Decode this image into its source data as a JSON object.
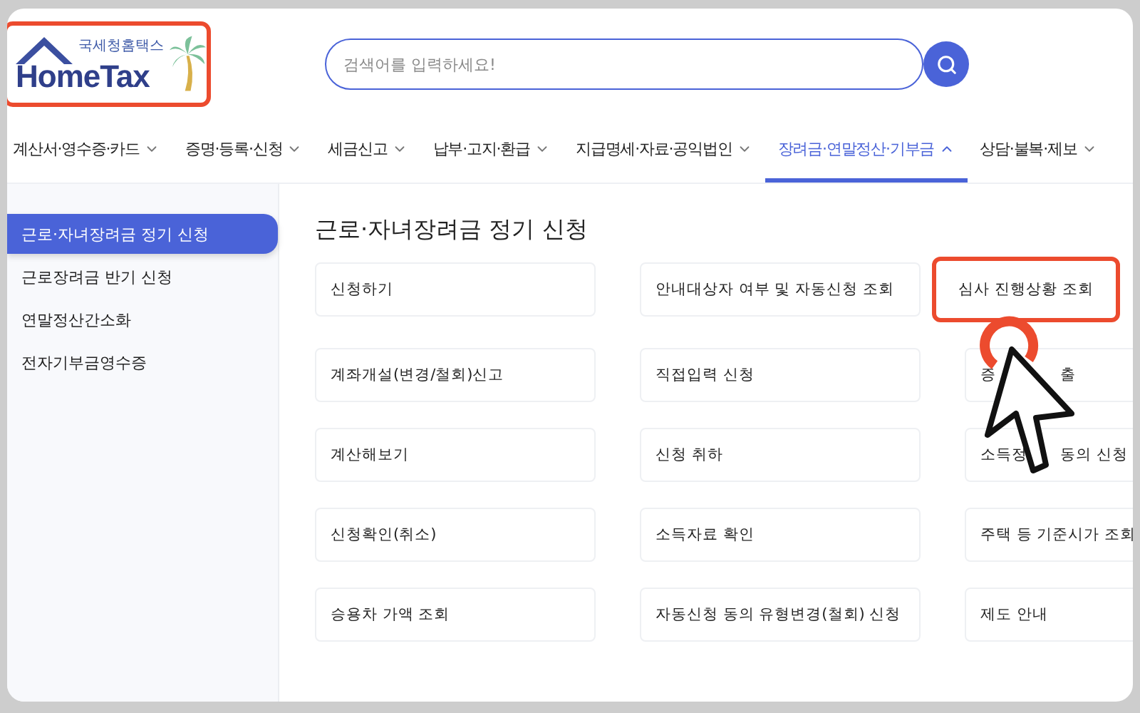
{
  "logo": {
    "subtitle": "국세청홈택스",
    "name": "HomeTax"
  },
  "search": {
    "placeholder": "검색어를 입력하세요!"
  },
  "nav": [
    {
      "label": "계산서·영수증·카드",
      "selected": false
    },
    {
      "label": "증명·등록·신청",
      "selected": false
    },
    {
      "label": "세금신고",
      "selected": false
    },
    {
      "label": "납부·고지·환급",
      "selected": false
    },
    {
      "label": "지급명세·자료·공익법인",
      "selected": false
    },
    {
      "label": "장려금·연말정산·기부금",
      "selected": true
    },
    {
      "label": "상담·불복·제보",
      "selected": false
    }
  ],
  "sidebar": {
    "items": [
      {
        "label": "근로·자녀장려금 정기 신청",
        "selected": true
      },
      {
        "label": "근로장려금 반기 신청",
        "selected": false
      },
      {
        "label": "연말정산간소화",
        "selected": false
      },
      {
        "label": "전자기부금영수증",
        "selected": false
      }
    ]
  },
  "main": {
    "title": "근로·자녀장려금 정기 신청",
    "cells": [
      {
        "text": "신청하기",
        "highlighted": false
      },
      {
        "text": "안내대상자 여부 및 자동신청 조회",
        "highlighted": false
      },
      {
        "text": "심사 진행상황 조회",
        "highlighted": true
      },
      {
        "text": "계좌개설(변경/철회)신고",
        "highlighted": false
      },
      {
        "text": "직접입력 신청",
        "highlighted": false
      },
      {
        "parts": [
          "증",
          "출"
        ],
        "highlighted": false
      },
      {
        "text": "계산해보기",
        "highlighted": false
      },
      {
        "text": "신청 취하",
        "highlighted": false
      },
      {
        "parts": [
          "소득정",
          "동의 신청"
        ],
        "highlighted": false
      },
      {
        "text": "신청확인(취소)",
        "highlighted": false
      },
      {
        "text": "소득자료 확인",
        "highlighted": false
      },
      {
        "text": "주택 등 기준시가 조회",
        "highlighted": false
      },
      {
        "text": "승용차 가액 조회",
        "highlighted": false
      },
      {
        "text": "자동신청 동의 유형변경(철회) 신청",
        "highlighted": false
      },
      {
        "text": "제도 안내",
        "highlighted": false
      }
    ]
  }
}
